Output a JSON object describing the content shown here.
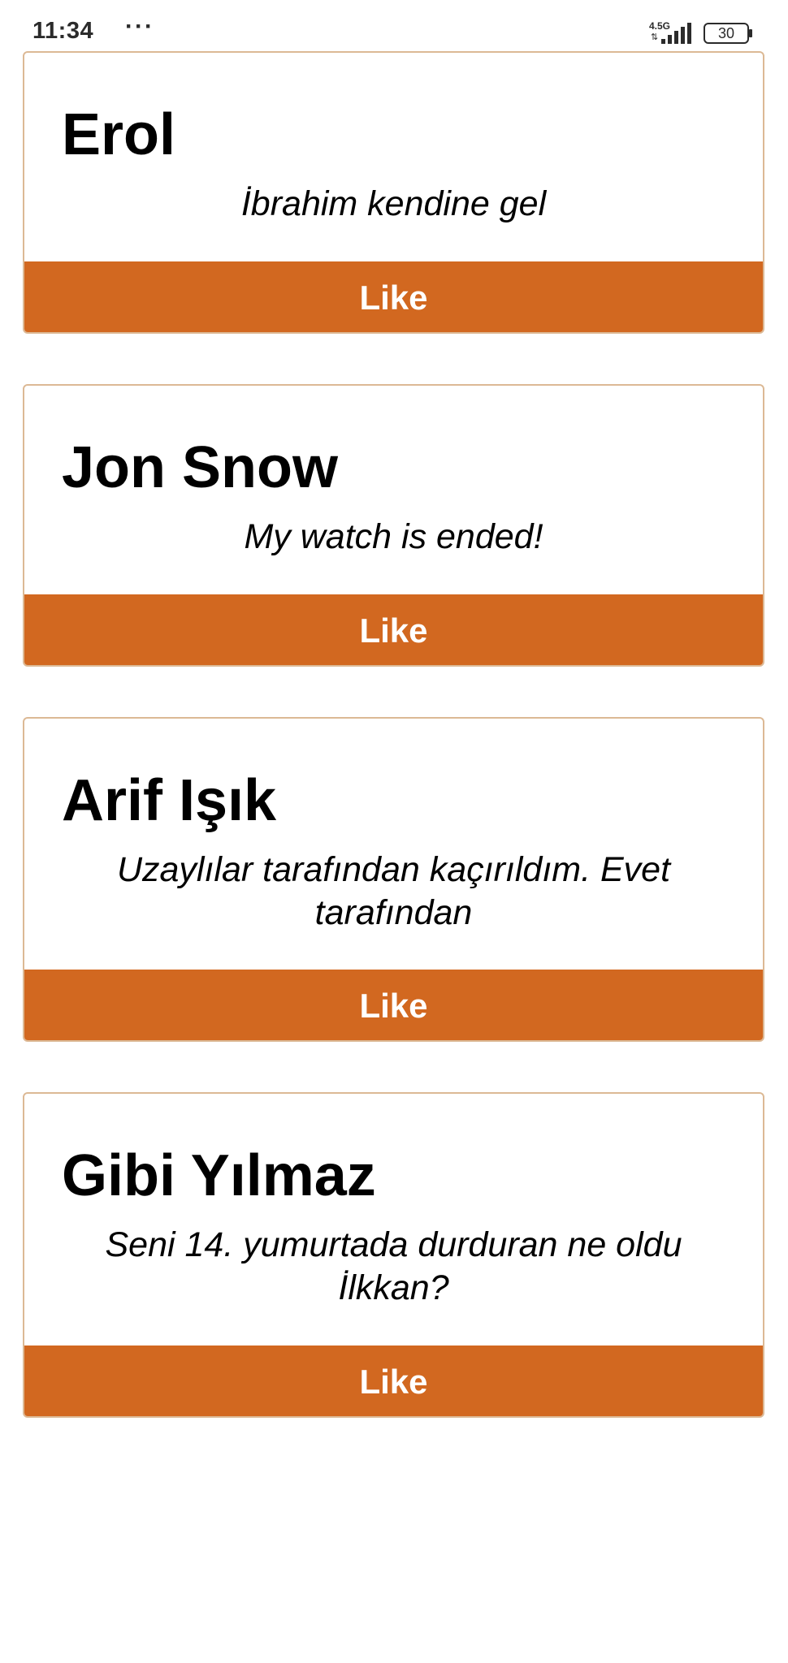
{
  "status_bar": {
    "time": "11:34",
    "more_dots": "···",
    "network": "4.5G",
    "data_arrows": "⇅",
    "battery": "30",
    "battery_level_percent": 30
  },
  "cards": [
    {
      "name": "Erol",
      "quote": "İbrahim kendine gel",
      "like_label": "Like"
    },
    {
      "name": "Jon Snow",
      "quote": "My watch is ended!",
      "like_label": "Like"
    },
    {
      "name": "Arif Işık",
      "quote": "Uzaylılar tarafından kaçırıldım. Evet tarafından",
      "like_label": "Like"
    },
    {
      "name": "Gibi Yılmaz",
      "quote": "Seni 14. yumurtada durduran ne oldu İlkkan?",
      "like_label": "Like"
    }
  ],
  "colors": {
    "accent": "#d26820",
    "card_border": "#dcb995",
    "background": "#ffffff"
  }
}
